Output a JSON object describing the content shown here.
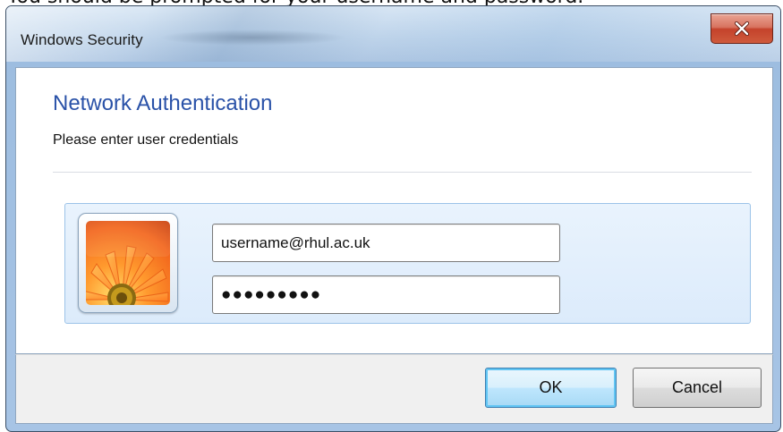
{
  "page": {
    "instruction_text": "You should be prompted for your username and password."
  },
  "window": {
    "title": "Windows Security",
    "close_icon": "close-icon"
  },
  "dialog": {
    "heading": "Network Authentication",
    "subheading": "Please enter user credentials",
    "avatar_icon": "user-avatar-flower-icon",
    "username_value": "username@rhul.ac.uk",
    "password_masked": "●●●●●●●●●",
    "ok_label": "OK",
    "cancel_label": "Cancel"
  },
  "colors": {
    "heading_blue": "#2a52a8",
    "close_red": "#c4422b",
    "tile_blue": "#dcebfb",
    "ok_focus": "#61c5f3"
  }
}
